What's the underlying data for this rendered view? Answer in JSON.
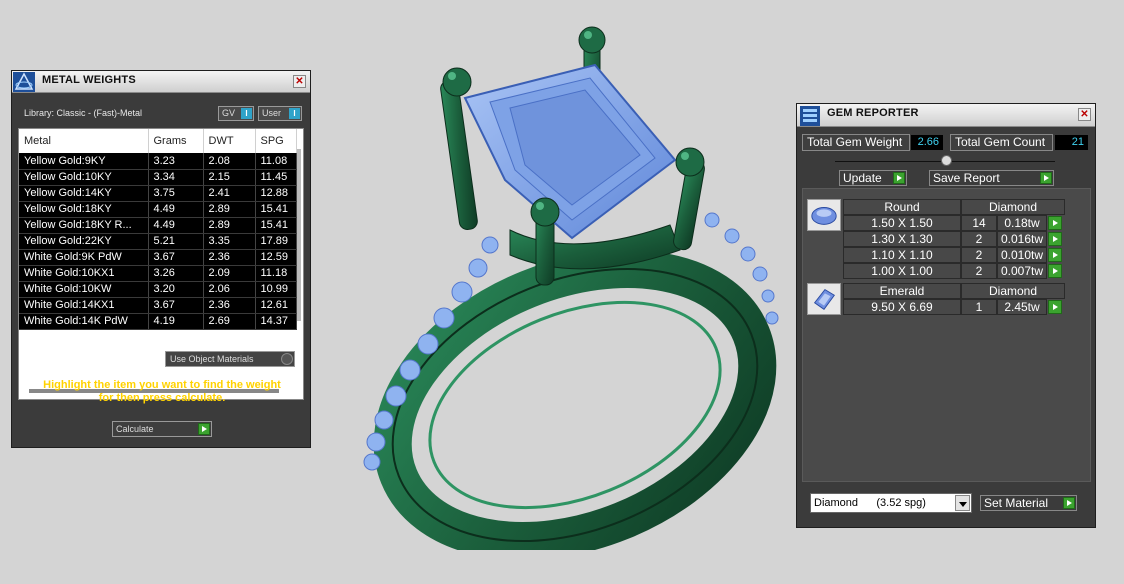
{
  "metal_weights": {
    "title": "METAL WEIGHTS",
    "library": "Library: Classic - (Fast)-Metal",
    "gv_label": "GV",
    "user_label": "User",
    "columns": [
      "Metal",
      "Grams",
      "DWT",
      "SPG"
    ],
    "rows": [
      [
        "Yellow Gold:9KY",
        "3.23",
        "2.08",
        "11.08"
      ],
      [
        "Yellow Gold:10KY",
        "3.34",
        "2.15",
        "11.45"
      ],
      [
        "Yellow Gold:14KY",
        "3.75",
        "2.41",
        "12.88"
      ],
      [
        "Yellow Gold:18KY",
        "4.49",
        "2.89",
        "15.41"
      ],
      [
        "Yellow Gold:18KY R...",
        "4.49",
        "2.89",
        "15.41"
      ],
      [
        "Yellow Gold:22KY",
        "5.21",
        "3.35",
        "17.89"
      ],
      [
        "White Gold:9K PdW",
        "3.67",
        "2.36",
        "12.59"
      ],
      [
        "White Gold:10KX1",
        "3.26",
        "2.09",
        "11.18"
      ],
      [
        "White Gold:10KW",
        "3.20",
        "2.06",
        "10.99"
      ],
      [
        "White Gold:14KX1",
        "3.67",
        "2.36",
        "12.61"
      ],
      [
        "White Gold:14K PdW",
        "4.19",
        "2.69",
        "14.37"
      ]
    ],
    "use_object_materials": "Use Object Materials",
    "hint_line1": "Highlight the item you want to find the weight",
    "hint_line2": "for then press calculate.",
    "calculate_label": "Calculate"
  },
  "gem_reporter": {
    "title": "GEM REPORTER",
    "total_weight_label": "Total Gem Weight",
    "total_weight_value": "2.66",
    "total_count_label": "Total Gem Count",
    "total_count_value": "21",
    "update_label": "Update",
    "save_report_label": "Save Report",
    "groups": [
      {
        "icon": "round-gem-icon",
        "shape": "Round",
        "material": "Diamond",
        "rows": [
          {
            "size": "1.50 X 1.50",
            "count": "14",
            "weight": "0.18tw"
          },
          {
            "size": "1.30 X 1.30",
            "count": "2",
            "weight": "0.016tw"
          },
          {
            "size": "1.10 X 1.10",
            "count": "2",
            "weight": "0.010tw"
          },
          {
            "size": "1.00 X 1.00",
            "count": "2",
            "weight": "0.007tw"
          }
        ]
      },
      {
        "icon": "emerald-gem-icon",
        "shape": "Emerald",
        "material": "Diamond",
        "rows": [
          {
            "size": "9.50 X 6.69",
            "count": "1",
            "weight": "2.45tw"
          }
        ]
      }
    ],
    "material_select": "Diamond      (3.52 spg)",
    "set_material_label": "Set Material"
  },
  "colors": {
    "ring_metal": "#1e6b45",
    "gem_blue": "#7aa2e8",
    "hint_yellow": "#ffd200",
    "value_cyan": "#3fd1f0",
    "button_green": "#3ba32f"
  }
}
